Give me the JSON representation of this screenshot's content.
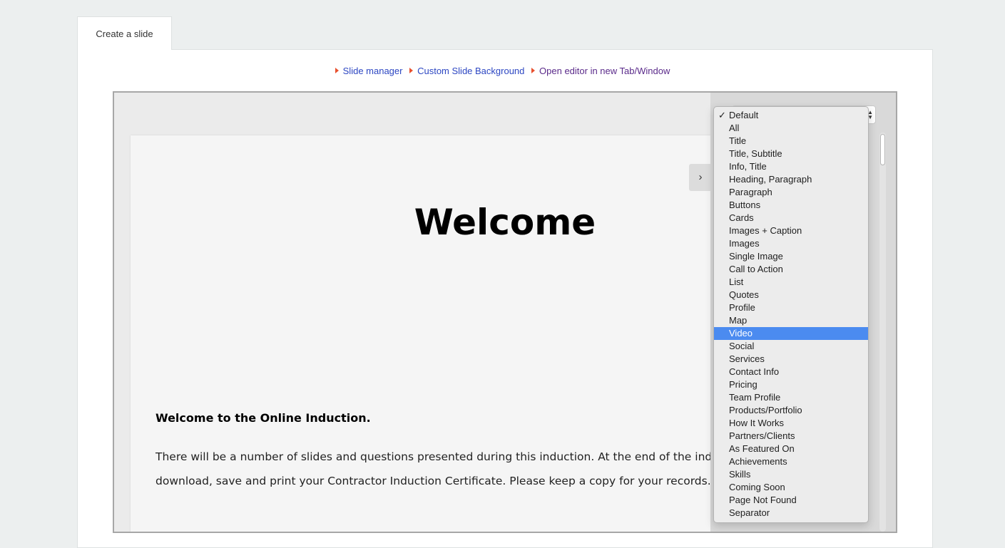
{
  "tab": {
    "label": "Create a slide"
  },
  "links": [
    {
      "label": "Slide manager"
    },
    {
      "label": "Custom Slide Background"
    },
    {
      "label": "Open editor in new Tab/Window"
    }
  ],
  "slide": {
    "title": "Welcome",
    "subtitle": "Welcome to the Online Induction.",
    "paragraph_line1": "There will be a number of slides and questions presented during this induction. At the end of the induc",
    "paragraph_line2": "download, save and print your Contractor Induction Certificate. Please keep a copy for your records."
  },
  "toggle": {
    "icon": "chevron-right-icon",
    "glyph": "›"
  },
  "layout_menu": {
    "checked": "Default",
    "highlighted": "Video",
    "highlight_color": "#4b8bf0",
    "options": [
      "Default",
      "All",
      "Title",
      "Title, Subtitle",
      "Info, Title",
      "Heading, Paragraph",
      "Paragraph",
      "Buttons",
      "Cards",
      "Images + Caption",
      "Images",
      "Single Image",
      "Call to Action",
      "List",
      "Quotes",
      "Profile",
      "Map",
      "Video",
      "Social",
      "Services",
      "Contact Info",
      "Pricing",
      "Team Profile",
      "Products/Portfolio",
      "How It Works",
      "Partners/Clients",
      "As Featured On",
      "Achievements",
      "Skills",
      "Coming Soon",
      "Page Not Found",
      "Separator"
    ]
  },
  "colors": {
    "link": "#2c46c2",
    "visited_link": "#5a2a8a",
    "link_arrow": "#e8512f"
  }
}
